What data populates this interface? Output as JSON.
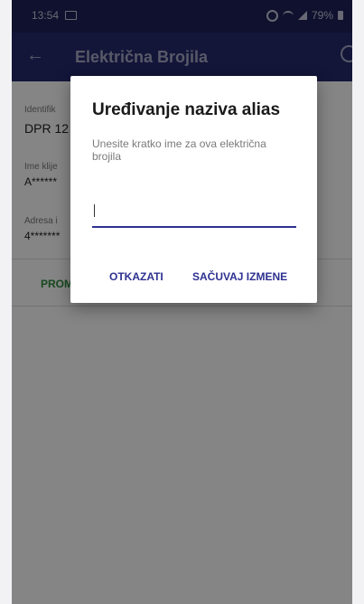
{
  "status_bar": {
    "time": "13:54",
    "battery": "79%"
  },
  "app_bar": {
    "title": "Električna Brojila"
  },
  "background_content": {
    "field1_label": "Identifik",
    "field1_value": "DPR 12",
    "field2_label": "Ime klije",
    "field2_value": "A******",
    "field3_label": "Adresa i",
    "field3_value": "4*******",
    "promo_label": "PROM"
  },
  "dialog": {
    "title": "Uređivanje naziva alias",
    "message": "Unesite kratko ime za ova električna brojila",
    "input_value": "",
    "cancel_label": "OTKAZATI",
    "save_label": "SAČUVAJ IZMENE"
  }
}
